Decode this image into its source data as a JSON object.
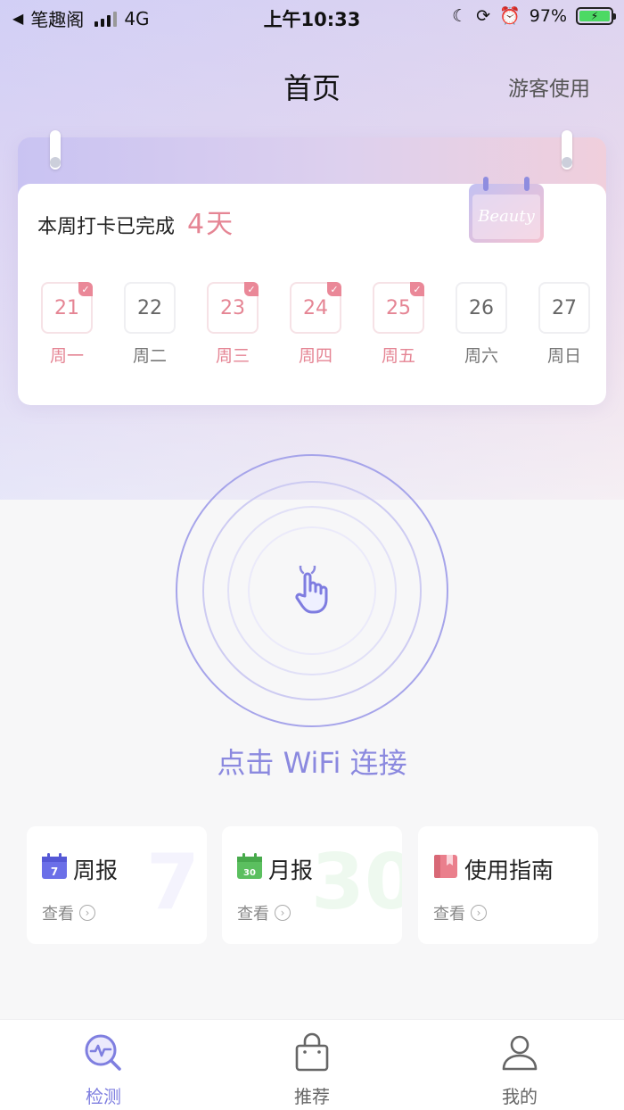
{
  "status_bar": {
    "carrier": "笔趣阁",
    "network": "4G",
    "time": "上午10:33",
    "battery": "97%"
  },
  "header": {
    "title": "首页",
    "guest_label": "游客使用"
  },
  "checkin": {
    "label": "本周打卡已完成",
    "days_done": "4天",
    "badge_text": "Beauty",
    "days": [
      {
        "date": "21",
        "weekday": "周一",
        "done": true
      },
      {
        "date": "22",
        "weekday": "周二",
        "done": false
      },
      {
        "date": "23",
        "weekday": "周三",
        "done": true
      },
      {
        "date": "24",
        "weekday": "周四",
        "done": true
      },
      {
        "date": "25",
        "weekday": "周五",
        "done": true
      },
      {
        "date": "26",
        "weekday": "周六",
        "done": false
      },
      {
        "date": "27",
        "weekday": "周日",
        "done": false
      }
    ]
  },
  "connect": {
    "text": "点击 WiFi 连接"
  },
  "cards": [
    {
      "title": "周报",
      "view": "查看",
      "icon_text": "7",
      "bg_number": "7",
      "color": "#6b6fe8"
    },
    {
      "title": "月报",
      "view": "查看",
      "icon_text": "30",
      "bg_number": "30",
      "color": "#5bbf5f"
    },
    {
      "title": "使用指南",
      "view": "查看",
      "icon_text": "",
      "bg_number": "",
      "color": "#ea7f8c"
    }
  ],
  "tabs": [
    {
      "label": "检测",
      "icon": "detect-icon",
      "active": true
    },
    {
      "label": "推荐",
      "icon": "shopping-bag-icon",
      "active": false
    },
    {
      "label": "我的",
      "icon": "user-icon",
      "active": false
    }
  ],
  "colors": {
    "accent": "#7f7fe0",
    "pink": "#e58594"
  }
}
